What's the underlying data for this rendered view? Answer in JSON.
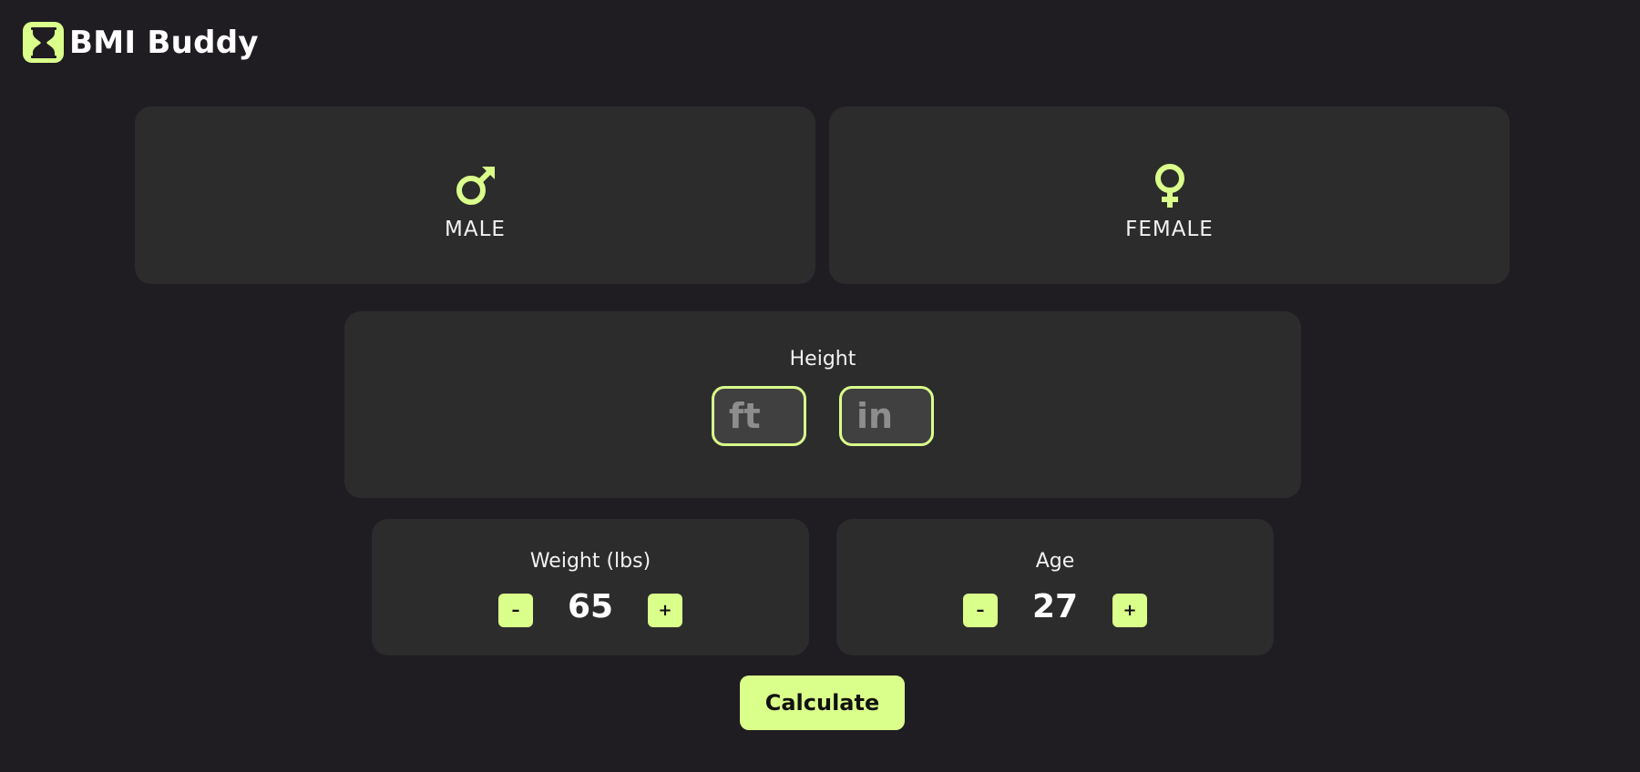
{
  "app": {
    "name": "BMI Buddy",
    "logo_icon": "hourglass-icon",
    "accent_color": "#daff8b",
    "background_color": "#1f1c22",
    "card_color": "#2c2c2c"
  },
  "gender": {
    "male": {
      "label": "MALE",
      "icon": "male-symbol-icon"
    },
    "female": {
      "label": "FEMALE",
      "icon": "female-symbol-icon"
    }
  },
  "height": {
    "label": "Height",
    "feet_placeholder": "ft",
    "inches_placeholder": "in",
    "feet_value": "",
    "inches_value": ""
  },
  "weight": {
    "label": "Weight (lbs)",
    "value": "65",
    "decrement_label": "–",
    "increment_label": "+"
  },
  "age": {
    "label": "Age",
    "value": "27",
    "decrement_label": "–",
    "increment_label": "+"
  },
  "calculate": {
    "label": "Calculate"
  }
}
